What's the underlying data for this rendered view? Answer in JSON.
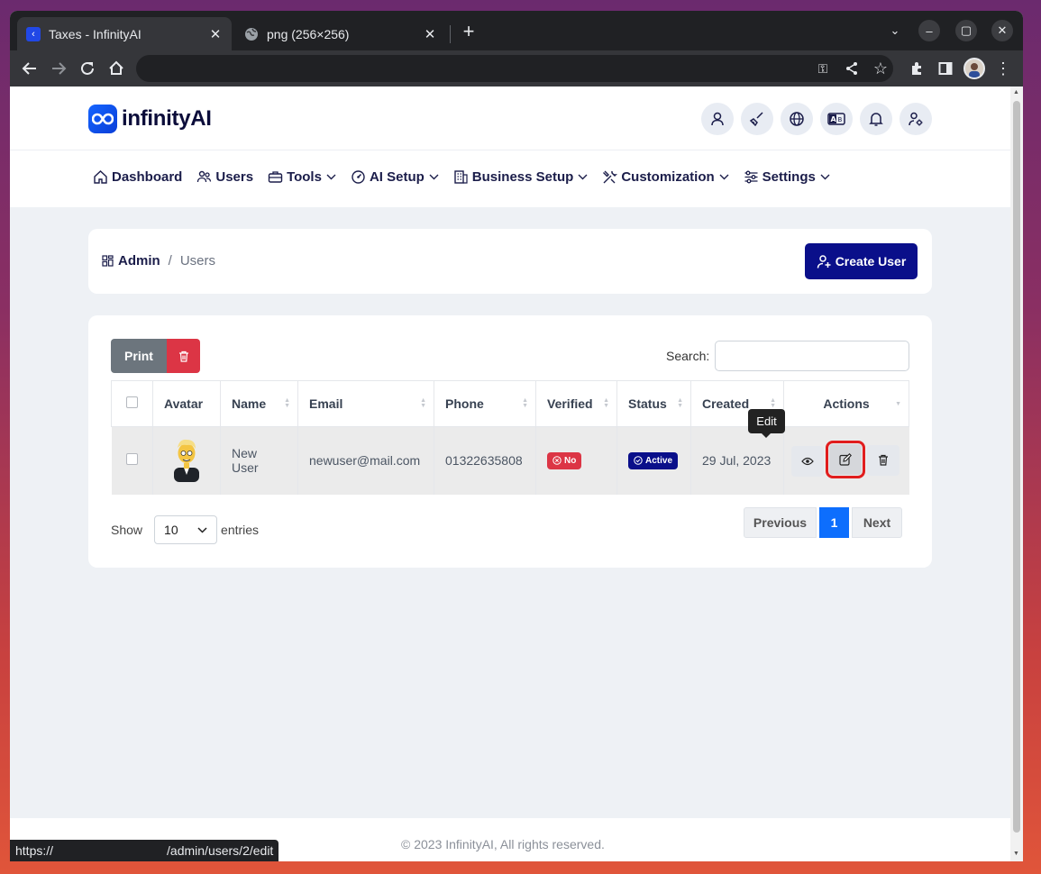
{
  "browser": {
    "tabs": [
      {
        "title": "Taxes - InfinityAI",
        "active": true
      },
      {
        "title": "png (256×256)",
        "active": false
      }
    ],
    "new_tab_label": "+",
    "status_url_prefix": "https://",
    "status_url_path": "/admin/users/2/edit"
  },
  "app": {
    "logo": "infinityAI",
    "header_icons": [
      "user-icon",
      "broom-icon",
      "globe-icon",
      "language-icon",
      "bell-icon",
      "user-settings-icon"
    ],
    "nav": [
      {
        "label": "Dashboard",
        "icon": "home-icon",
        "dropdown": false
      },
      {
        "label": "Users",
        "icon": "users-icon",
        "dropdown": false
      },
      {
        "label": "Tools",
        "icon": "briefcase-icon",
        "dropdown": true
      },
      {
        "label": "AI Setup",
        "icon": "gauge-icon",
        "dropdown": true
      },
      {
        "label": "Business Setup",
        "icon": "building-icon",
        "dropdown": true
      },
      {
        "label": "Customization",
        "icon": "tools-icon",
        "dropdown": true
      },
      {
        "label": "Settings",
        "icon": "sliders-icon",
        "dropdown": true
      }
    ]
  },
  "breadcrumb": {
    "root": "Admin",
    "separator": "/",
    "current": "Users"
  },
  "create_button": "Create User",
  "table": {
    "print_label": "Print",
    "search_label": "Search:",
    "search_value": "",
    "columns": [
      "Avatar",
      "Name",
      "Email",
      "Phone",
      "Verified",
      "Status",
      "Created",
      "Actions"
    ],
    "rows": [
      {
        "name": "New User",
        "email": "newuser@mail.com",
        "phone": "01322635808",
        "verified": "No",
        "status": "Active",
        "created": "29 Jul, 2023"
      }
    ],
    "tooltip": "Edit",
    "show_label": "Show",
    "page_size": "10",
    "entries_label": "entries",
    "pagination": {
      "previous": "Previous",
      "current": "1",
      "next": "Next"
    }
  },
  "footer": "© 2023 InfinityAI, All rights reserved.",
  "colors": {
    "primary": "#0a0f8a",
    "danger": "#dc3545",
    "highlight": "#e11d1d",
    "page_link": "#0d6efd"
  }
}
